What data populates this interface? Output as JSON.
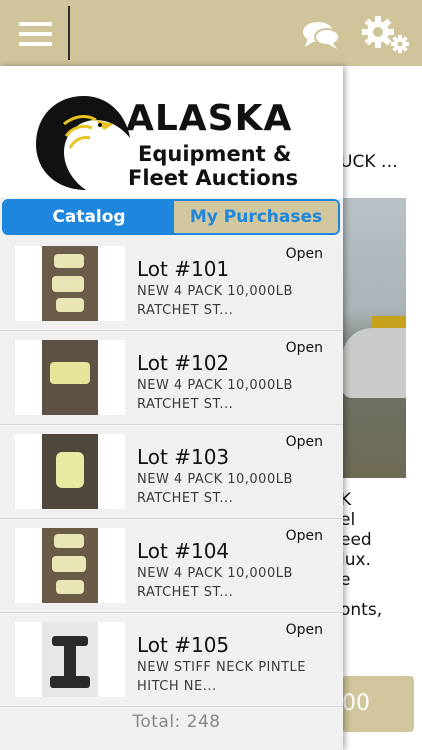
{
  "background": {
    "text_line_1": "UCK …",
    "text_block": [
      "K",
      "el",
      "eed",
      "lux.",
      "e",
      "",
      "onts,"
    ],
    "button_label": "00"
  },
  "logo": {
    "line1": "ALASKA",
    "line2": "Equipment &",
    "line3": "Fleet Auctions"
  },
  "tabs": {
    "catalog": "Catalog",
    "my_purchases": "My Purchases"
  },
  "lots": [
    {
      "title": "Lot #101",
      "desc_line1": "NEW 4 PACK 10,000LB",
      "desc_line2": "RATCHET ST...",
      "status": "Open"
    },
    {
      "title": "Lot #102",
      "desc_line1": "NEW 4 PACK 10,000LB",
      "desc_line2": "RATCHET ST...",
      "status": "Open"
    },
    {
      "title": "Lot #103",
      "desc_line1": "NEW 4 PACK 10,000LB",
      "desc_line2": "RATCHET ST...",
      "status": "Open"
    },
    {
      "title": "Lot #104",
      "desc_line1": "NEW 4 PACK 10,000LB",
      "desc_line2": "RATCHET ST...",
      "status": "Open"
    },
    {
      "title": "Lot #105",
      "desc_line1": "NEW STIFF NECK PINTLE",
      "desc_line2": "HITCH NE...",
      "status": "Open"
    }
  ],
  "total_label": "Total: 248",
  "colors": {
    "accent": "#1f86de",
    "brand": "#d0c49a"
  }
}
